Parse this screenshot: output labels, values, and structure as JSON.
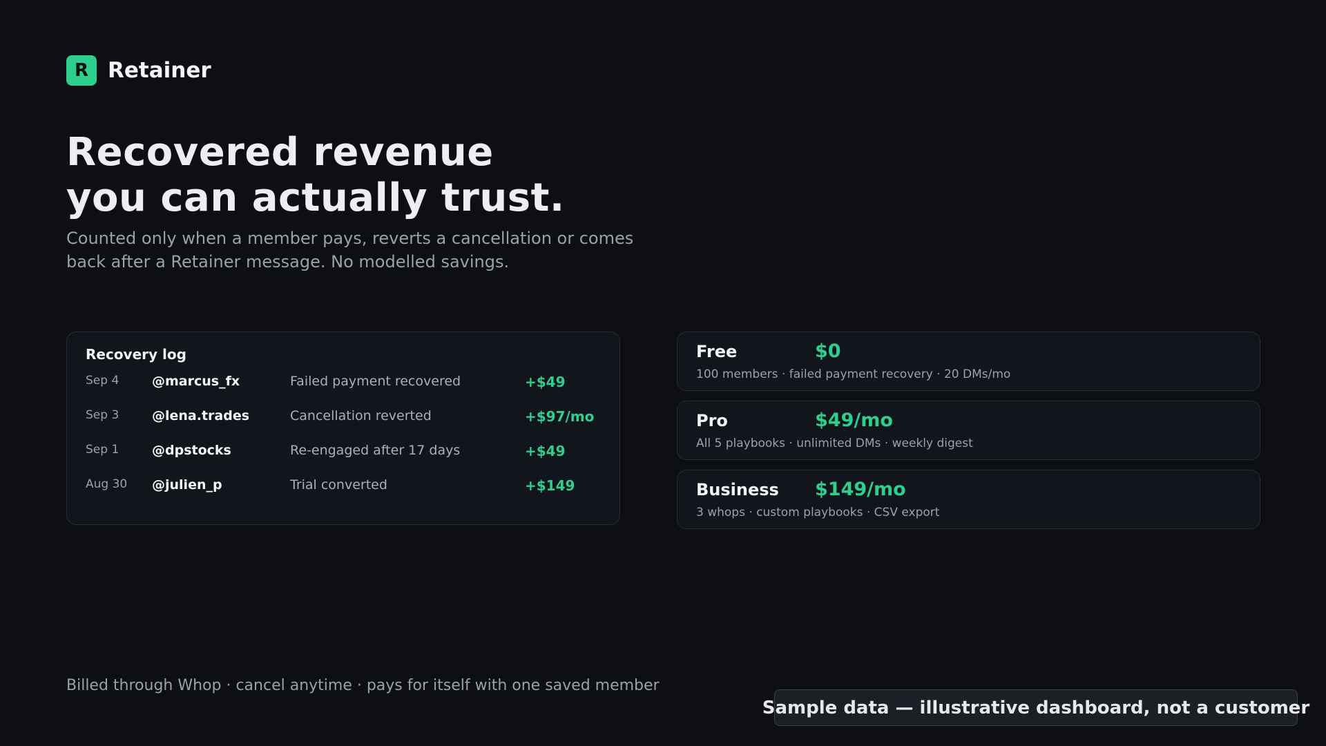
{
  "brand": {
    "logo_letter": "R",
    "name": "Retainer"
  },
  "hero": {
    "title_line1": "Recovered revenue",
    "title_line2": "you can actually trust.",
    "subtitle": "Counted only when a member pays, reverts a cancellation or comes back after a Retainer message. No modelled savings."
  },
  "recovery_log": {
    "title": "Recovery log",
    "rows": [
      {
        "date": "Sep 4",
        "user": "@marcus_fx",
        "event": "Failed payment recovered",
        "amount": "+$49"
      },
      {
        "date": "Sep 3",
        "user": "@lena.trades",
        "event": "Cancellation reverted",
        "amount": "+$97/mo"
      },
      {
        "date": "Sep 1",
        "user": "@dpstocks",
        "event": "Re-engaged after 17 days",
        "amount": "+$49"
      },
      {
        "date": "Aug 30",
        "user": "@julien_p",
        "event": "Trial converted",
        "amount": "+$149"
      }
    ]
  },
  "plans": [
    {
      "name": "Free",
      "price": "$0",
      "features": "100 members · failed payment recovery · 20 DMs/mo"
    },
    {
      "name": "Pro",
      "price": "$49/mo",
      "features": "All 5 playbooks · unlimited DMs · weekly digest"
    },
    {
      "name": "Business",
      "price": "$149/mo",
      "features": "3 whops · custom playbooks · CSV export"
    }
  ],
  "footer": {
    "note": "Billed through Whop · cancel anytime · pays for itself with one saved member",
    "badge": "Sample data — illustrative dashboard, not a customer"
  },
  "colors": {
    "accent": "#2ecf8e",
    "background": "#0d0f13",
    "card": "#12161c"
  }
}
